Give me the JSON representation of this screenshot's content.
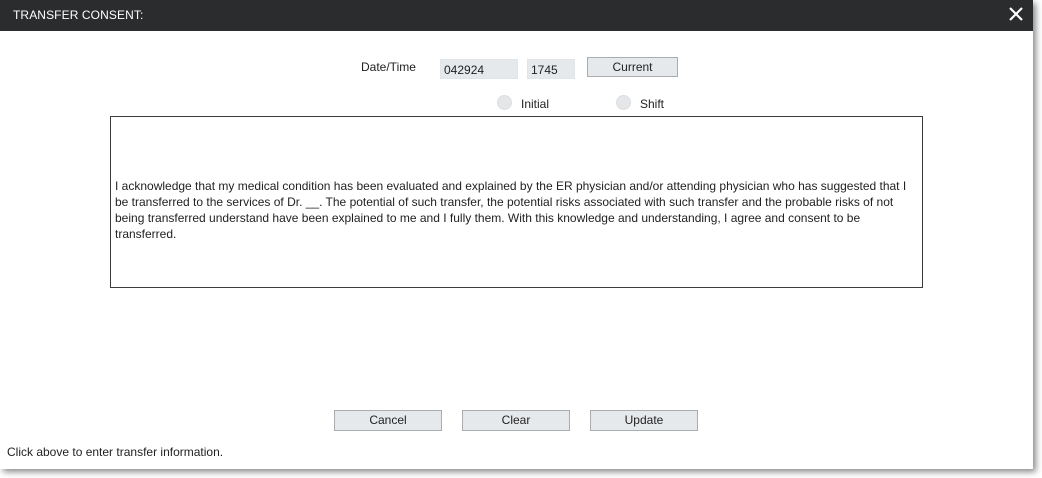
{
  "window": {
    "title": "TRANSFER CONSENT:",
    "close_icon": "close-icon"
  },
  "form": {
    "datetime_label": "Date/Time",
    "date_value": "042924",
    "time_value": "1745",
    "current_button": "Current",
    "radio_options": [
      {
        "label": "Initial",
        "selected": false
      },
      {
        "label": "Shift",
        "selected": false
      }
    ],
    "consent_text": "I acknowledge that my medical condition has been evaluated and explained by the ER physician and/or attending physician who has suggested that I be transferred to the services of Dr. __. The potential of such transfer, the potential risks associated with such transfer and the probable risks of not being transferred understand have been explained to me and I fully them. With this knowledge and understanding, I agree and consent to be transferred."
  },
  "actions": {
    "cancel": "Cancel",
    "clear": "Clear",
    "update": "Update"
  },
  "status_text": "Click above to enter transfer information.",
  "colors": {
    "titlebar": "#2a2c2e",
    "button_bg": "#e6e9ec",
    "field_bg": "#e6e9ec"
  }
}
